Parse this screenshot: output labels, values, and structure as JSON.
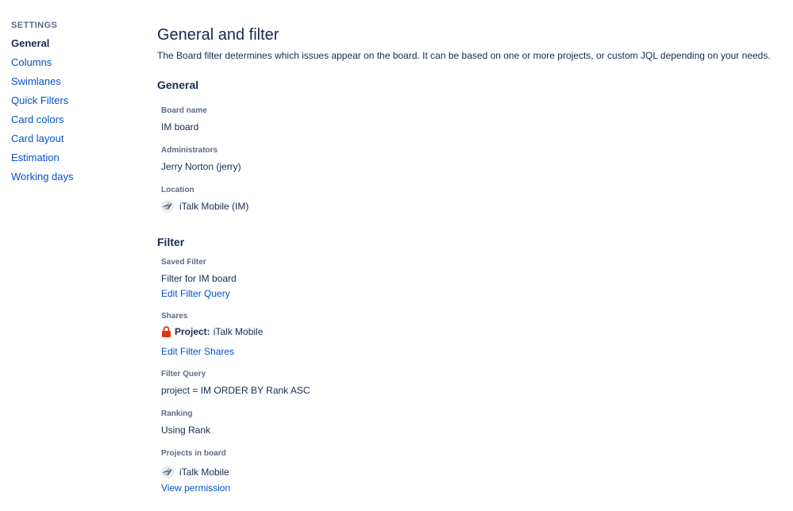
{
  "sidebar": {
    "heading": "SETTINGS",
    "items": [
      {
        "label": "General",
        "active": true
      },
      {
        "label": "Columns"
      },
      {
        "label": "Swimlanes"
      },
      {
        "label": "Quick Filters"
      },
      {
        "label": "Card colors"
      },
      {
        "label": "Card layout"
      },
      {
        "label": "Estimation"
      },
      {
        "label": "Working days"
      }
    ]
  },
  "main": {
    "title": "General and filter",
    "description": "The Board filter determines which issues appear on the board. It can be based on one or more projects, or custom JQL depending on your needs.",
    "general": {
      "heading": "General",
      "board_name_label": "Board name",
      "board_name": "IM board",
      "administrators_label": "Administrators",
      "administrators": "Jerry Norton (jerry)",
      "location_label": "Location",
      "location": "iTalk Mobile (IM)"
    },
    "filter": {
      "heading": "Filter",
      "saved_filter_label": "Saved Filter",
      "saved_filter": "Filter for IM board",
      "edit_query_link": "Edit Filter Query",
      "shares_label": "Shares",
      "shares_type": "Project:",
      "shares_value": "iTalk Mobile",
      "edit_shares_link": "Edit Filter Shares",
      "query_label": "Filter Query",
      "query": "project = IM ORDER BY Rank ASC",
      "ranking_label": "Ranking",
      "ranking": "Using Rank",
      "projects_label": "Projects in board",
      "project": "iTalk Mobile",
      "view_permission_link": "View permission"
    }
  },
  "icons": {
    "project": "italk-mobile-project-icon",
    "lock": "lock-icon"
  },
  "colors": {
    "link": "#0052cc",
    "text": "#172b4d",
    "subtle": "#5e6c84",
    "lock": "#de350b"
  }
}
